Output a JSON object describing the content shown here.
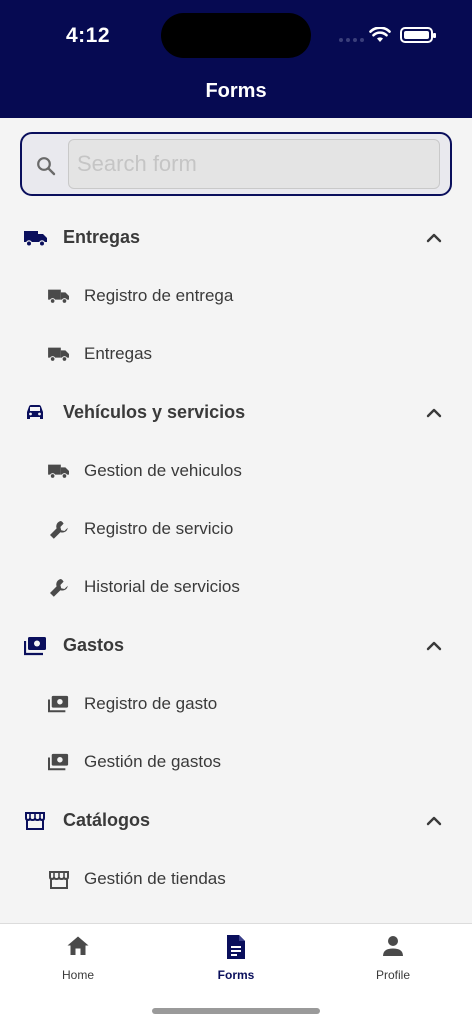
{
  "status_bar": {
    "time": "4:12"
  },
  "header": {
    "title": "Forms"
  },
  "search": {
    "placeholder": "Search form",
    "value": ""
  },
  "sections": [
    {
      "label": "Entregas",
      "icon": "truck-icon",
      "items": [
        {
          "label": "Registro de entrega",
          "icon": "truck-icon"
        },
        {
          "label": "Entregas",
          "icon": "truck-icon"
        }
      ]
    },
    {
      "label": "Vehículos y servicios",
      "icon": "car-icon",
      "items": [
        {
          "label": "Gestion de vehiculos",
          "icon": "truck-icon"
        },
        {
          "label": "Registro de servicio",
          "icon": "wrench-icon"
        },
        {
          "label": "Historial de servicios",
          "icon": "wrench-icon"
        }
      ]
    },
    {
      "label": "Gastos",
      "icon": "money-icon",
      "items": [
        {
          "label": "Registro de gasto",
          "icon": "money-icon"
        },
        {
          "label": "Gestión de gastos",
          "icon": "money-icon"
        }
      ]
    },
    {
      "label": "Catálogos",
      "icon": "store-icon",
      "items": [
        {
          "label": "Gestión de tiendas",
          "icon": "store-icon"
        }
      ]
    }
  ],
  "tabs": [
    {
      "label": "Home",
      "icon": "home-icon",
      "active": false
    },
    {
      "label": "Forms",
      "icon": "document-icon",
      "active": true
    },
    {
      "label": "Profile",
      "icon": "person-icon",
      "active": false
    }
  ],
  "colors": {
    "primary": "#060a52",
    "text": "#3a3a3a",
    "background": "#f4f4f4"
  }
}
